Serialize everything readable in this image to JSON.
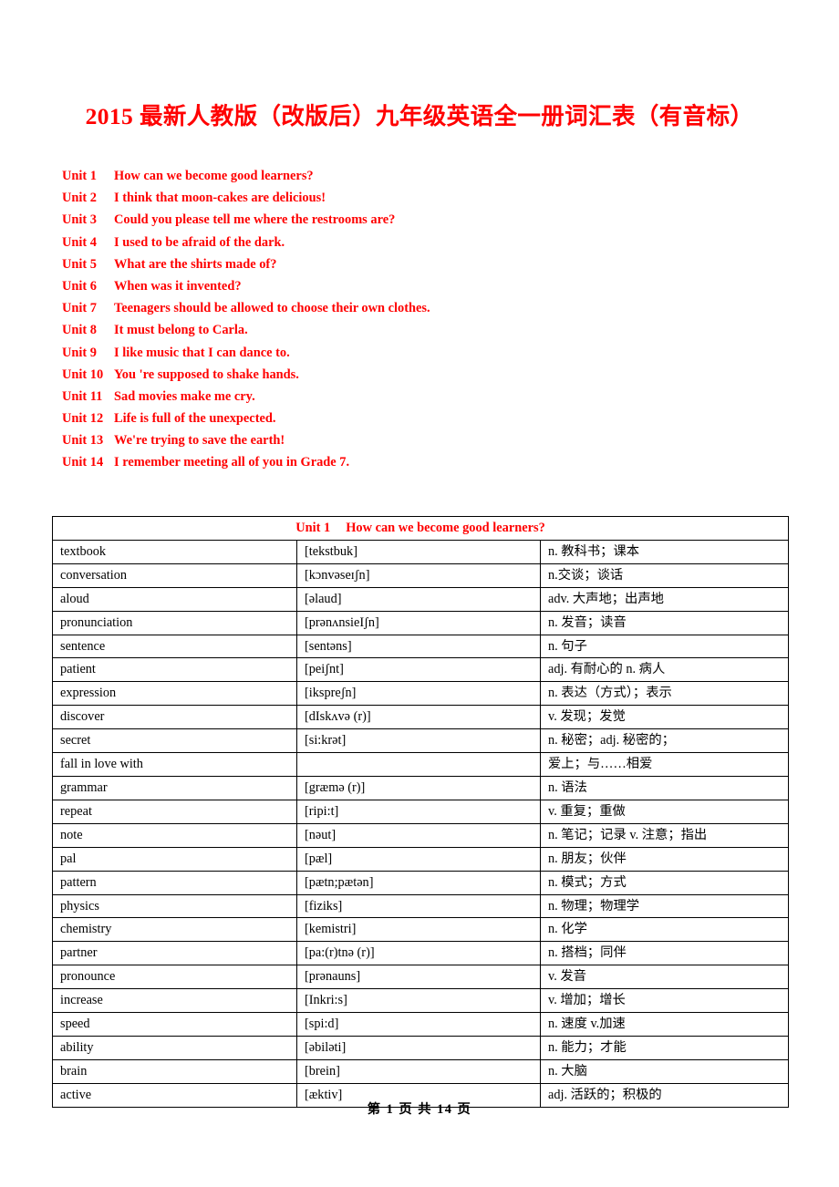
{
  "document": {
    "title": "2015 最新人教版（改版后）九年级英语全一册词汇表（有音标）",
    "title_color": "#FF0000",
    "footer": "第 1 页 共 14 页"
  },
  "unit_index": {
    "items": [
      {
        "no": "Unit 1",
        "title": "How can we become good learners?"
      },
      {
        "no": "Unit 2",
        "title": "I think that moon-cakes are delicious!"
      },
      {
        "no": "Unit 3",
        "title": "Could you please tell me where the restrooms are?"
      },
      {
        "no": "Unit 4",
        "title": "I used to be afraid of the dark."
      },
      {
        "no": "Unit 5",
        "title": "What are the shirts made of?"
      },
      {
        "no": "Unit 6",
        "title": "When was it invented?"
      },
      {
        "no": "Unit 7",
        "title": "Teenagers should be allowed to choose their own clothes."
      },
      {
        "no": "Unit 8",
        "title": "It must belong to Carla."
      },
      {
        "no": "Unit 9",
        "title": "I like music that I can dance to."
      },
      {
        "no": "Unit 10",
        "title": "You 're supposed to shake hands."
      },
      {
        "no": "Unit 11",
        "title": "Sad movies make me cry."
      },
      {
        "no": "Unit 12",
        "title": "Life is full of the unexpected."
      },
      {
        "no": "Unit 13",
        "title": "We're trying to save the earth!"
      },
      {
        "no": "Unit 14",
        "title": "I remember meeting all of you in Grade 7."
      }
    ]
  },
  "vocab_table": {
    "header": {
      "no": "Unit 1",
      "title": "How can we become good learners?"
    },
    "rows": [
      {
        "word": "textbook",
        "pron": "[tekstbuk]",
        "meaning": "n. 教科书；课本"
      },
      {
        "word": "conversation",
        "pron": "[kɔnvəseɪʃn]",
        "meaning": "n.交谈；谈话"
      },
      {
        "word": "aloud",
        "pron": "[əlaud]",
        "meaning": "adv. 大声地；出声地"
      },
      {
        "word": "pronunciation",
        "pron": "[prənʌnsieIʃn]",
        "meaning": "n. 发音；读音"
      },
      {
        "word": "sentence",
        "pron": "[sentəns]",
        "meaning": "n. 句子"
      },
      {
        "word": "patient",
        "pron": "[peiʃnt]",
        "meaning": "adj. 有耐心的   n. 病人"
      },
      {
        "word": "expression",
        "pron": "[ikspreʃn]",
        "meaning": "n. 表达（方式）；表示"
      },
      {
        "word": "discover",
        "pron": "[dIskʌvə (r)]",
        "meaning": "v. 发现；发觉"
      },
      {
        "word": "secret",
        "pron": "[si:krət]",
        "meaning": "n. 秘密；adj. 秘密的；"
      },
      {
        "word": "fall in love with",
        "pron": "",
        "meaning": "爱上；与……相爱"
      },
      {
        "word": "grammar",
        "pron": "[græmə (r)]",
        "meaning": "n. 语法"
      },
      {
        "word": "repeat",
        "pron": "[ripi:t]",
        "meaning": "v. 重复；重做"
      },
      {
        "word": "note",
        "pron": "[nəut]",
        "meaning": "n. 笔记；记录 v. 注意；指出"
      },
      {
        "word": "pal",
        "pron": "[pæl]",
        "meaning": "n. 朋友；伙伴"
      },
      {
        "word": "pattern",
        "pron": "[pætn;pætən]",
        "meaning": "n. 模式；方式"
      },
      {
        "word": "physics",
        "pron": "[fiziks]",
        "meaning": "n. 物理；物理学"
      },
      {
        "word": "chemistry",
        "pron": "[kemistri]",
        "meaning": "n. 化学"
      },
      {
        "word": "partner",
        "pron": "[pa:(r)tnə (r)]",
        "meaning": "n. 搭档；同伴"
      },
      {
        "word": "pronounce",
        "pron": "[prənauns]",
        "meaning": "v. 发音"
      },
      {
        "word": "increase",
        "pron": "[Inkri:s]",
        "meaning": "v. 增加；增长"
      },
      {
        "word": "speed",
        "pron": "[spi:d]",
        "meaning": "n. 速度   v.加速"
      },
      {
        "word": "ability",
        "pron": "[əbiləti]",
        "meaning": "n. 能力；才能"
      },
      {
        "word": "brain",
        "pron": "[brein]",
        "meaning": "n. 大脑"
      },
      {
        "word": "active",
        "pron": "[æktiv]",
        "meaning": "adj. 活跃的；积极的"
      }
    ]
  }
}
